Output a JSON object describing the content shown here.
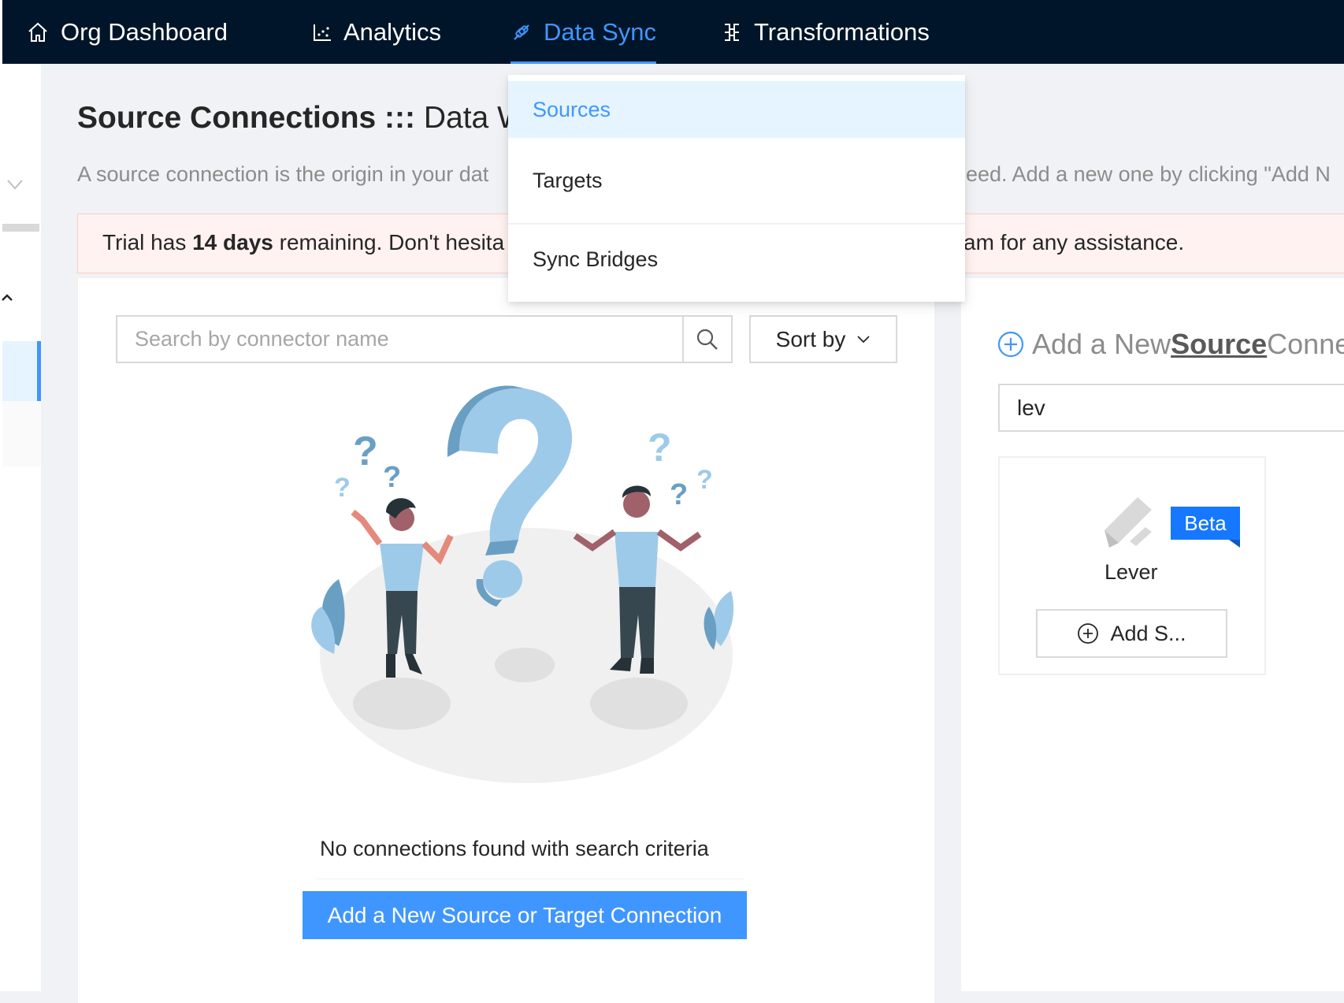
{
  "nav": {
    "items": [
      {
        "label": "Org Dashboard",
        "icon": "home-icon"
      },
      {
        "label": "Analytics",
        "icon": "chart-icon"
      },
      {
        "label": "Data Sync",
        "icon": "sync-link-icon"
      },
      {
        "label": "Transformations",
        "icon": "transform-icon"
      }
    ],
    "active": "Data Sync"
  },
  "dropdown": {
    "items": [
      "Sources",
      "Targets",
      "Sync Bridges"
    ],
    "selected": "Sources"
  },
  "page": {
    "title_bold": "Source Connections :::",
    "title_rest": " Data Wa",
    "description_left": "A source connection is the origin in your dat",
    "description_right": "eed. Add a new one by clicking \"Add N"
  },
  "alert": {
    "pre": "Trial has ",
    "days": "14 days",
    "post": " remaining. Don't hesita",
    "right": "am for any assistance."
  },
  "search": {
    "placeholder": "Search by connector name",
    "value": ""
  },
  "sort": {
    "label": "Sort by"
  },
  "empty_state": {
    "message": "No connections found with search criteria",
    "button_label": "Add a New Source or Target Connection"
  },
  "add_panel": {
    "heading_pre": "Add a New ",
    "heading_bold": "Source",
    "heading_post": " Conne",
    "filter_value": "lev",
    "connector": {
      "name": "Lever",
      "badge": "Beta",
      "button_label": "Add S..."
    }
  },
  "colors": {
    "topbar": "#001529",
    "accent": "#4096ff",
    "alert_bg": "#fff2f0",
    "primary_button": "#4096ff",
    "beta_badge": "#1677ff"
  }
}
